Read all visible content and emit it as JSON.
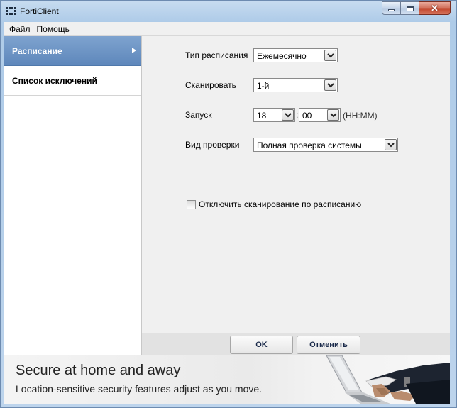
{
  "window": {
    "title": "FortiClient"
  },
  "menu": {
    "items": [
      "Файл",
      "Помощь"
    ]
  },
  "sidebar": {
    "items": [
      {
        "label": "Расписание",
        "active": true
      },
      {
        "label": "Список исключений",
        "active": false
      }
    ]
  },
  "form": {
    "schedule_type": {
      "label": "Тип расписания",
      "value": "Ежемесячно"
    },
    "scan": {
      "label": "Сканировать",
      "value": "1-й"
    },
    "start": {
      "label": "Запуск",
      "hour": "18",
      "separator": ":",
      "minute": "00",
      "hint": "(HH:MM)"
    },
    "scan_type": {
      "label": "Вид проверки",
      "value": "Полная проверка системы"
    },
    "disable_schedule": {
      "label": "Отключить сканирование по расписанию",
      "checked": false
    }
  },
  "buttons": {
    "ok": "OK",
    "cancel": "Отменить"
  },
  "banner": {
    "title": "Secure at home and away",
    "subtitle": "Location-sensitive security features adjust as you move."
  },
  "colors": {
    "sidebar_active": "#5e87bb",
    "titlebar": "#bdd4ec",
    "close_button": "#c1432a"
  }
}
